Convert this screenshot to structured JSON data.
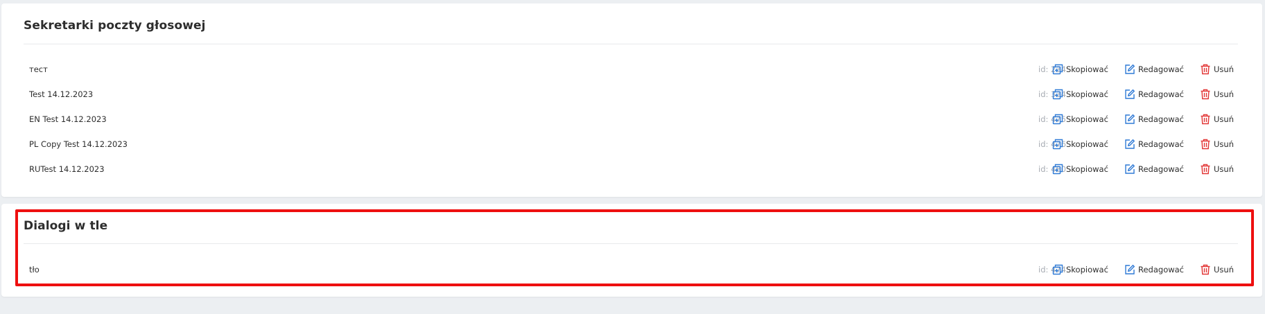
{
  "sections": [
    {
      "title": "Sekretarki poczty głosowej",
      "rows": [
        {
          "name": "тест",
          "id": "id: 234"
        },
        {
          "name": "Test 14.12.2023",
          "id": "id: 334"
        },
        {
          "name": "EN Test 14.12.2023",
          "id": "id: 475"
        },
        {
          "name": "PL Copy Test 14.12.2023",
          "id": "id: 476"
        },
        {
          "name": "RUTest 14.12.2023",
          "id": "id: 480"
        }
      ]
    },
    {
      "title": "Dialogi w tle",
      "rows": [
        {
          "name": "tło",
          "id": "id: 474"
        }
      ]
    }
  ],
  "actions": {
    "copy_label": "Skopiować",
    "edit_label": "Redagować",
    "delete_label": "Usuń"
  },
  "icons": {
    "copy": "copy-plus-icon",
    "edit": "edit-pencil-icon",
    "delete": "trash-icon"
  },
  "colors": {
    "accent_blue": "#2f7ad6",
    "delete_red": "#e23434",
    "highlight_red": "#ee0f0f",
    "muted_gray": "#a7acb3"
  }
}
